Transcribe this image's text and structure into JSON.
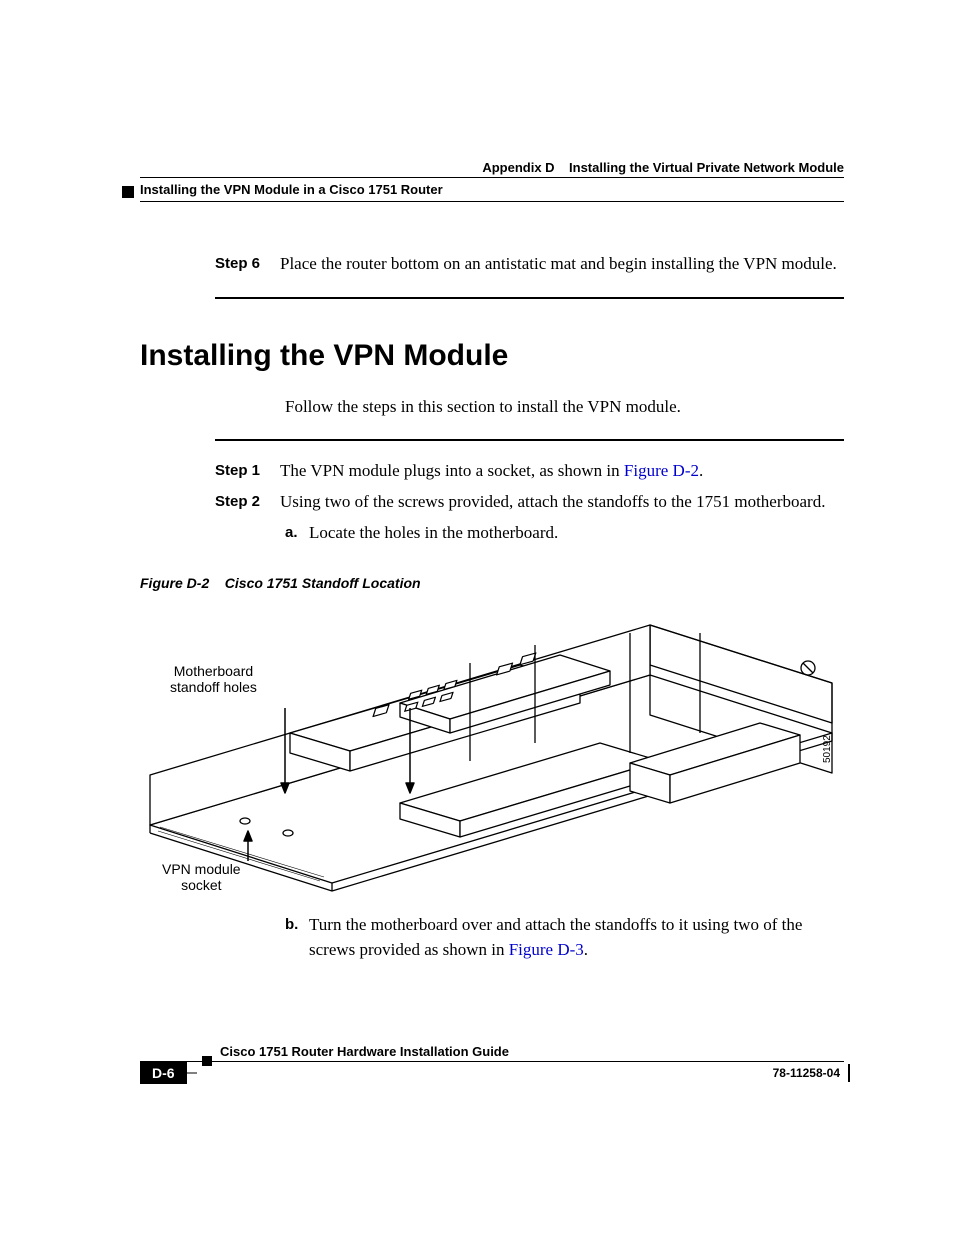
{
  "header": {
    "right": "Appendix D    Installing the Virtual Private Network Module",
    "left": "Installing the VPN Module in a Cisco 1751 Router"
  },
  "step6": {
    "label": "Step 6",
    "text": "Place the router bottom on an antistatic mat and begin installing the VPN module."
  },
  "section": {
    "title": "Installing the VPN Module",
    "intro": "Follow the steps in this section to install the VPN module."
  },
  "step1": {
    "label": "Step 1",
    "pre": "The VPN module plugs into a socket, as shown in ",
    "link": "Figure D-2",
    "post": "."
  },
  "step2": {
    "label": "Step 2",
    "text": "Using two of the screws provided, attach the standoffs to the 1751 motherboard."
  },
  "sub_a": {
    "label": "a.",
    "text": "Locate the holes in the motherboard."
  },
  "figure": {
    "caption": "Figure D-2    Cisco 1751 Standoff Location",
    "callout1_line1": "Motherboard",
    "callout1_line2": "standoff holes",
    "callout2_line1": "VPN module",
    "callout2_line2": "socket",
    "id": "50192"
  },
  "sub_b": {
    "label": "b.",
    "pre": "Turn the motherboard over and attach the standoffs to it using two of the screws provided as shown in ",
    "link": "Figure D-3",
    "post": "."
  },
  "footer": {
    "doc_title": "Cisco 1751 Router Hardware Installation Guide",
    "page": "D-6",
    "doc_num": "78-11258-04"
  }
}
